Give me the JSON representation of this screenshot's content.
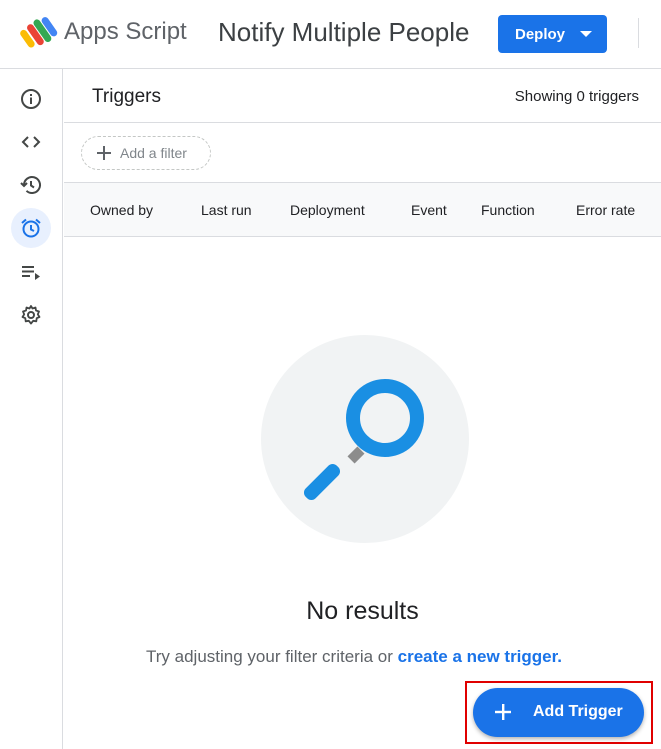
{
  "header": {
    "app_name": "Apps Script",
    "project_title": "Notify Multiple People",
    "deploy_label": "Deploy"
  },
  "sidebar": {
    "items": [
      {
        "icon": "info-icon"
      },
      {
        "icon": "code-icon"
      },
      {
        "icon": "history-icon"
      },
      {
        "icon": "alarm-clock-icon",
        "active": true
      },
      {
        "icon": "executions-icon"
      },
      {
        "icon": "gear-icon"
      }
    ]
  },
  "triggers": {
    "title": "Triggers",
    "showing": "Showing 0 triggers",
    "add_filter": "Add a filter",
    "columns": [
      "Owned by",
      "Last run",
      "Deployment",
      "Event",
      "Function",
      "Error rate"
    ]
  },
  "empty_state": {
    "title": "No results",
    "hint_prefix": "Try adjusting your filter criteria or",
    "hint_link": "create a new trigger."
  },
  "fab": {
    "label": "Add Trigger"
  },
  "colors": {
    "accent": "#1a73e8",
    "highlight": "#e00000",
    "active_nav_bg": "#e8f0fe"
  }
}
